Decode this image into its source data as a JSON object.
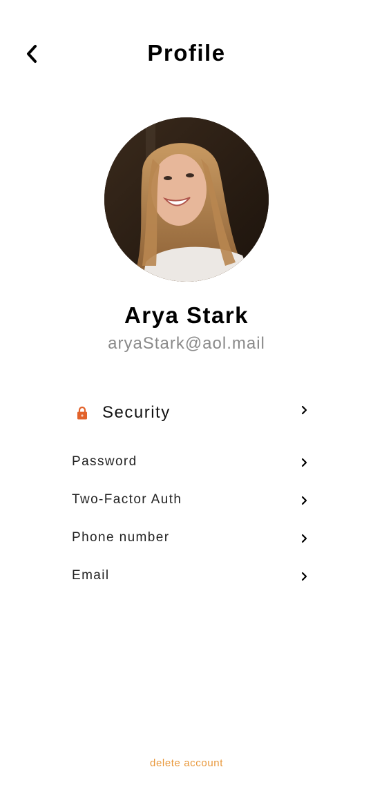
{
  "header": {
    "back_icon": "chevron-left-icon",
    "title": "Profile"
  },
  "profile": {
    "avatar": "user-photo",
    "name": "Arya Stark",
    "email": "aryaStark@aol.mail"
  },
  "security": {
    "icon": "lock-icon",
    "label": "Security",
    "items": [
      {
        "label": "Password"
      },
      {
        "label": "Two-Factor Auth"
      },
      {
        "label": "Phone number"
      },
      {
        "label": "Email"
      }
    ]
  },
  "footer": {
    "delete_label": "delete account"
  },
  "colors": {
    "accent": "#e8973a",
    "lock": "#e2622a",
    "email_text": "#8a8a8a"
  }
}
